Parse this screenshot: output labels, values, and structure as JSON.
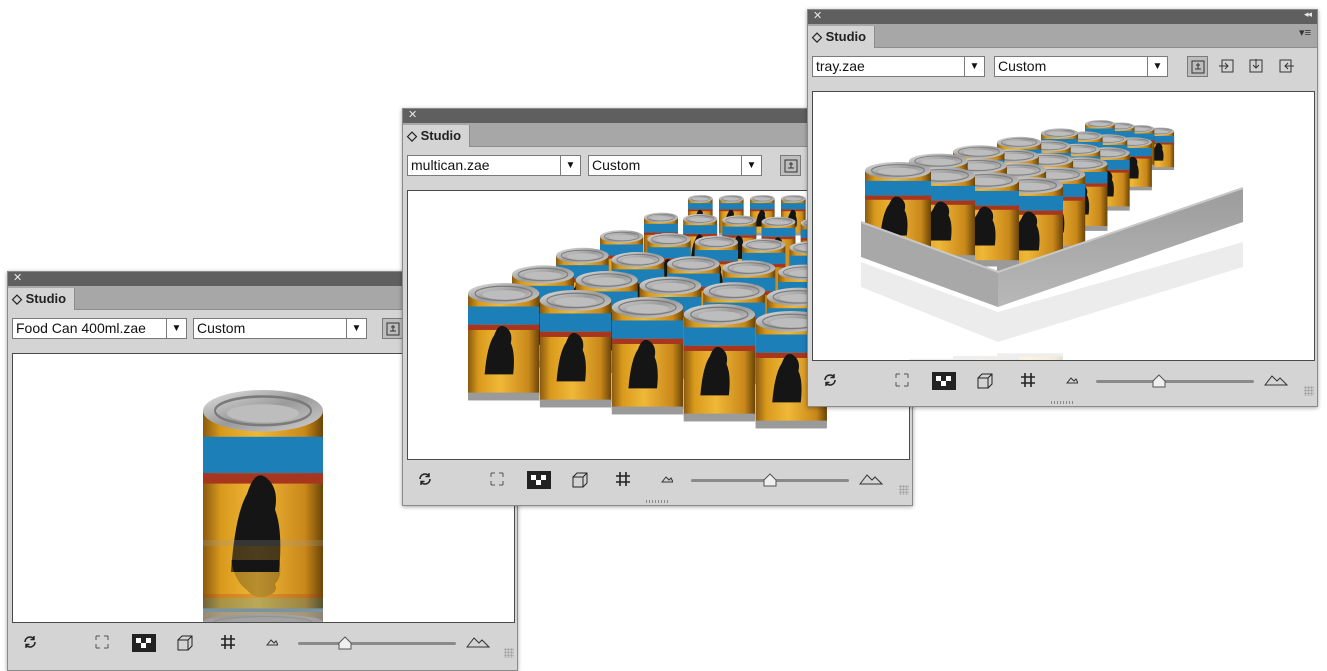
{
  "panels": [
    {
      "id": "food-can",
      "tab_label": "Studio",
      "model_file": "Food Can 400ml.zae",
      "preset": "Custom",
      "slider_value": 0.3
    },
    {
      "id": "multican",
      "tab_label": "Studio",
      "model_file": "multican.zae",
      "preset": "Custom",
      "slider_value": 0.5
    },
    {
      "id": "tray",
      "tab_label": "Studio",
      "model_file": "tray.zae",
      "preset": "Custom",
      "slider_value": 0.4
    }
  ],
  "icons": {
    "close": "close-icon",
    "collapse": "collapse-double-arrow-icon",
    "panel_menu": "panel-menu-icon",
    "tab_toggle": "updown-chevron-icon",
    "dropdown_arrow": "triangle-down-icon",
    "bottom_tools": [
      "reset-rotate-icon",
      "fit-view-icon",
      "background-checker-icon",
      "bounding-box-icon",
      "grid-icon",
      "zoom-out-mountain-icon",
      "zoom-in-mountain-icon"
    ]
  },
  "colors": {
    "titlebar": "#5f5f5f",
    "panel_bg": "#d4d4d4",
    "tab_strip": "#a7a7a7",
    "can_label_yellow": "#e9a822",
    "can_label_blue": "#1d7fb8"
  }
}
